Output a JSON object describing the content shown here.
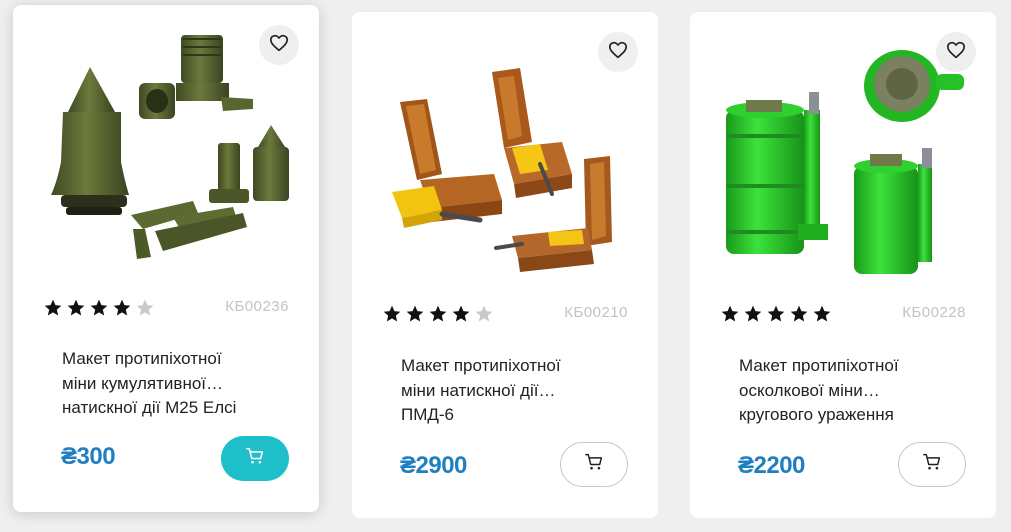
{
  "colors": {
    "accent": "#1fbfc9",
    "price": "#1f7fc2",
    "code": "#c3c3c3"
  },
  "products": [
    {
      "code": "КБ00236",
      "title_line1": "Макет протипіхотної",
      "title_line2": "міни кумулятивної…",
      "title_line3": "натискної дії М25 Елсі",
      "price": "₴300",
      "rating": 4,
      "rating_max": 5,
      "cart_state": "active",
      "image_icon": "olive-mine-model-image"
    },
    {
      "code": "КБ00210",
      "title_line1": "Макет протипіхотної",
      "title_line2": "міни натискної дії…",
      "title_line3": "ПМД-6",
      "price": "₴2900",
      "rating": 4,
      "rating_max": 5,
      "cart_state": "outline",
      "image_icon": "wooden-box-mine-image"
    },
    {
      "code": "КБ00228",
      "title_line1": "Макет протипіхотної",
      "title_line2": "осколкової міни…",
      "title_line3": "кругового ураження",
      "price": "₴2200",
      "rating": 5,
      "rating_max": 5,
      "cart_state": "outline",
      "image_icon": "green-cylinder-mine-image"
    }
  ]
}
